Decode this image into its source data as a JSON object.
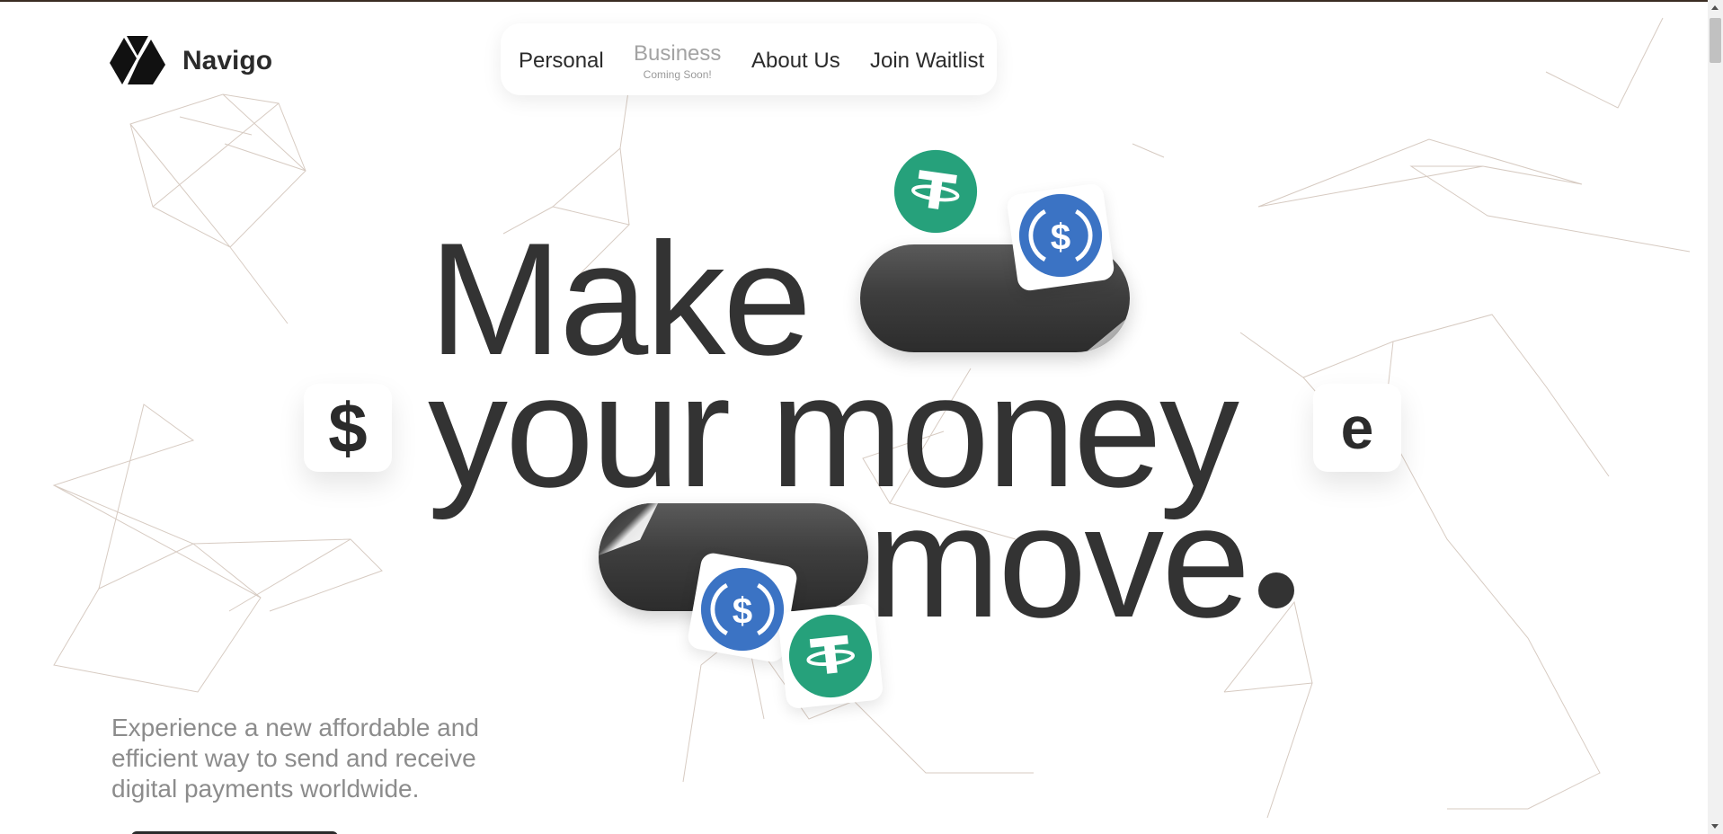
{
  "brand": {
    "name": "Navigo",
    "logo_icon": "navigo-triangle-logo"
  },
  "nav": {
    "items": [
      {
        "label": "Personal"
      },
      {
        "label": "Business",
        "sublabel": "Coming Soon!"
      },
      {
        "label": "About Us"
      },
      {
        "label": "Join Waitlist"
      }
    ]
  },
  "hero": {
    "line1": "Make",
    "line2": "your money",
    "line3": "move",
    "left_tile": "$",
    "right_tile": "e",
    "coins": [
      "usdt-coin-icon",
      "usdc-coin-icon",
      "usdc-coin-icon",
      "usdt-coin-icon"
    ]
  },
  "tagline": "Experience a new affordable and efficient way to send and receive digital payments worldwide.",
  "colors": {
    "text_dark": "#333333",
    "text_muted": "#8c8c8c",
    "usdt_green": "#26a17b",
    "usdc_blue": "#2775ca",
    "mesh_line": "#c9b9ad"
  }
}
